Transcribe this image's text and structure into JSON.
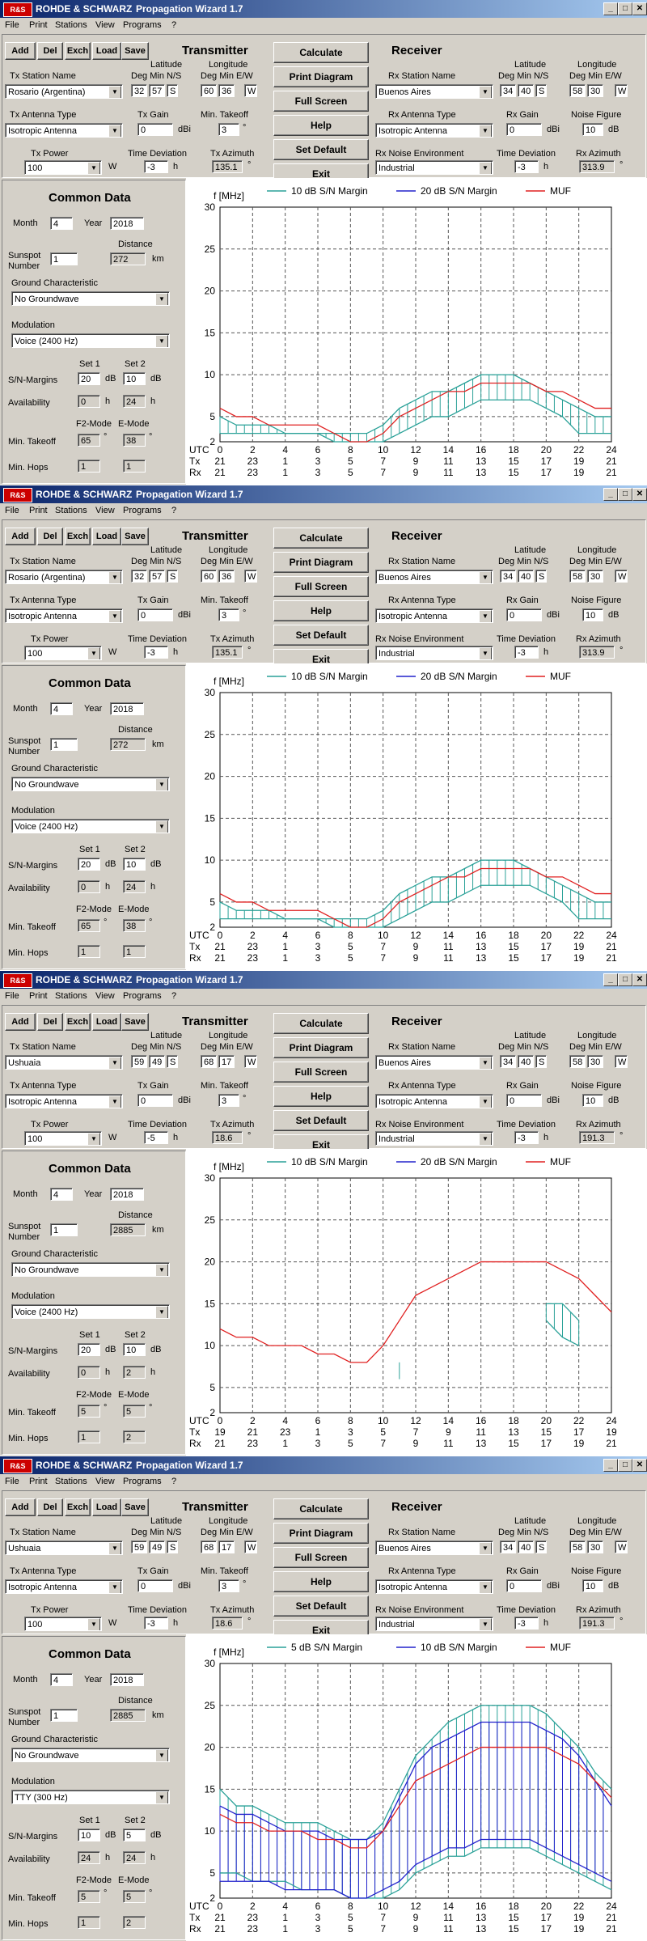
{
  "app": {
    "brand": "ROHDE & SCHWARZ",
    "brand_short": "R&S",
    "title": "Propagation Wizard  1.7"
  },
  "menu": [
    "File",
    "Print",
    "Stations",
    "View",
    "Programs",
    "?"
  ],
  "toolbar": [
    "Add",
    "Del",
    "Exch",
    "Load",
    "Save"
  ],
  "actions": [
    "Calculate",
    "Print Diagram",
    "Full Screen",
    "Help",
    "Set Default",
    "Exit"
  ],
  "labels": {
    "transmitter": "Transmitter",
    "receiver": "Receiver",
    "common": "Common Data",
    "tx_station": "Tx Station Name",
    "rx_station": "Rx Station Name",
    "latitude": "Latitude",
    "longitude": "Longitude",
    "lat_sub": "Deg  Min  N/S",
    "lon_sub": "Deg  Min E/W",
    "tx_ant": "Tx Antenna Type",
    "tx_gain": "Tx Gain",
    "min_takeoff": "Min. Takeoff",
    "rx_ant": "Rx Antenna Type",
    "rx_gain": "Rx Gain",
    "noise_fig": "Noise Figure",
    "tx_power": "Tx Power",
    "time_dev": "Time Deviation",
    "tx_az": "Tx Azimuth",
    "rx_noise": "Rx Noise Environment",
    "rx_az": "Rx Azimuth",
    "dbi": "dBi",
    "db": "dB",
    "deg": "°",
    "h": "h",
    "w": "W",
    "km": "km",
    "month": "Month",
    "year": "Year",
    "sunspot": "Sunspot\nNumber",
    "distance": "Distance",
    "ground": "Ground Characteristic",
    "modulation": "Modulation",
    "sn": "S/N-Margins",
    "avail": "Availability",
    "takeoff": "Min. Takeoff",
    "hops": "Min. Hops",
    "set1": "Set 1",
    "set2": "Set 2",
    "f2": "F2-Mode",
    "emode": "E-Mode",
    "fmhz": "f [MHz]",
    "utc": "UTC",
    "tx": "Tx",
    "rx": "Rx"
  },
  "colors": {
    "margin1": "#2aa198",
    "margin2": "#2222cc",
    "muf": "#e02020",
    "grid": "#555555"
  },
  "windows": [
    {
      "tx": {
        "station": "Rosario (Argentina)",
        "lat_deg": "32",
        "lat_min": "57",
        "lat_ns": "S",
        "lon_deg": "60",
        "lon_min": "36",
        "lon_ew": "W",
        "antenna": "Isotropic Antenna",
        "gain": "0",
        "takeoff": "3",
        "power": "100",
        "timedev": "-3",
        "azimuth": "135.1"
      },
      "rx": {
        "station": "Buenos Aires",
        "lat_deg": "34",
        "lat_min": "40",
        "lat_ns": "S",
        "lon_deg": "58",
        "lon_min": "30",
        "lon_ew": "W",
        "antenna": "Isotropic Antenna",
        "gain": "0",
        "noise": "10",
        "environment": "Industrial",
        "timedev": "-3",
        "azimuth": "313.9"
      },
      "common": {
        "month": "4",
        "year": "2018",
        "sunspot": "1",
        "distance": "272",
        "ground": "No Groundwave",
        "modulation": "Voice   (2400 Hz)",
        "sn1": "20",
        "sn2": "10",
        "av1": "0",
        "av2": "24",
        "f2_1": "65",
        "f2_2": "38",
        "hop1": "1",
        "hop2": "1"
      },
      "tx_hours": [
        "21",
        "23",
        "1",
        "3",
        "5",
        "7",
        "9",
        "11",
        "13",
        "15",
        "17",
        "19",
        "21"
      ],
      "rx_hours": [
        "21",
        "23",
        "1",
        "3",
        "5",
        "7",
        "9",
        "11",
        "13",
        "15",
        "17",
        "19",
        "21"
      ],
      "chart_data": {
        "type": "line",
        "ylabel": "f [MHz]",
        "xlabel": "UTC",
        "x_ticks": [
          0,
          2,
          4,
          6,
          8,
          10,
          12,
          14,
          16,
          18,
          20,
          22,
          24
        ],
        "y_ticks": [
          2,
          5,
          10,
          15,
          20,
          25,
          30
        ],
        "ylim": [
          2,
          30
        ],
        "xlim": [
          0,
          24
        ],
        "legend": [
          "10 dB S/N Margin",
          "20 dB S/N Margin",
          "MUF"
        ],
        "x": [
          0,
          1,
          2,
          3,
          4,
          5,
          6,
          7,
          8,
          9,
          10,
          11,
          12,
          13,
          14,
          15,
          16,
          17,
          18,
          19,
          20,
          21,
          22,
          23,
          24
        ],
        "series": [
          {
            "name": "MUF",
            "values": [
              6,
              5,
              5,
              4,
              4,
              4,
              4,
              3,
              2,
              2,
              3,
              5,
              6,
              7,
              8,
              8,
              9,
              9,
              9,
              9,
              8,
              8,
              7,
              6,
              6
            ]
          },
          {
            "name": "10 dB S/N Margin upper",
            "values": [
              5,
              4,
              4,
              4,
              3,
              3,
              3,
              3,
              3,
              3,
              4,
              6,
              7,
              8,
              8,
              9,
              10,
              10,
              10,
              9,
              8,
              7,
              6,
              5,
              5
            ]
          },
          {
            "name": "10 dB S/N Margin lower",
            "values": [
              3,
              3,
              3,
              3,
              3,
              3,
              3,
              2,
              2,
              2,
              2,
              3,
              4,
              5,
              5,
              6,
              7,
              7,
              7,
              7,
              6,
              5,
              3,
              3,
              3
            ]
          }
        ]
      }
    },
    {
      "tx": {
        "station": "Rosario (Argentina)",
        "lat_deg": "32",
        "lat_min": "57",
        "lat_ns": "S",
        "lon_deg": "60",
        "lon_min": "36",
        "lon_ew": "W",
        "antenna": "Isotropic Antenna",
        "gain": "0",
        "takeoff": "3",
        "power": "100",
        "timedev": "-3",
        "azimuth": "135.1"
      },
      "rx": {
        "station": "Buenos Aires",
        "lat_deg": "34",
        "lat_min": "40",
        "lat_ns": "S",
        "lon_deg": "58",
        "lon_min": "30",
        "lon_ew": "W",
        "antenna": "Isotropic Antenna",
        "gain": "0",
        "noise": "10",
        "environment": "Industrial",
        "timedev": "-3",
        "azimuth": "313.9"
      },
      "common": {
        "month": "4",
        "year": "2018",
        "sunspot": "1",
        "distance": "272",
        "ground": "No Groundwave",
        "modulation": "Voice   (2400 Hz)",
        "sn1": "20",
        "sn2": "10",
        "av1": "0",
        "av2": "24",
        "f2_1": "65",
        "f2_2": "38",
        "hop1": "1",
        "hop2": "1"
      },
      "tx_hours": [
        "21",
        "23",
        "1",
        "3",
        "5",
        "7",
        "9",
        "11",
        "13",
        "15",
        "17",
        "19",
        "21"
      ],
      "rx_hours": [
        "21",
        "23",
        "1",
        "3",
        "5",
        "7",
        "9",
        "11",
        "13",
        "15",
        "17",
        "19",
        "21"
      ],
      "chart_data": {
        "type": "line",
        "ylabel": "f [MHz]",
        "xlabel": "UTC",
        "x_ticks": [
          0,
          2,
          4,
          6,
          8,
          10,
          12,
          14,
          16,
          18,
          20,
          22,
          24
        ],
        "y_ticks": [
          2,
          5,
          10,
          15,
          20,
          25,
          30
        ],
        "ylim": [
          2,
          30
        ],
        "xlim": [
          0,
          24
        ],
        "legend": [
          "10 dB S/N Margin",
          "20 dB S/N Margin",
          "MUF"
        ],
        "x": [
          0,
          1,
          2,
          3,
          4,
          5,
          6,
          7,
          8,
          9,
          10,
          11,
          12,
          13,
          14,
          15,
          16,
          17,
          18,
          19,
          20,
          21,
          22,
          23,
          24
        ],
        "series": [
          {
            "name": "MUF",
            "values": [
              6,
              5,
              5,
              4,
              4,
              4,
              4,
              3,
              2,
              2,
              3,
              5,
              6,
              7,
              8,
              8,
              9,
              9,
              9,
              9,
              8,
              8,
              7,
              6,
              6
            ]
          },
          {
            "name": "10 dB S/N Margin upper",
            "values": [
              5,
              4,
              4,
              4,
              3,
              3,
              3,
              3,
              3,
              3,
              4,
              6,
              7,
              8,
              8,
              9,
              10,
              10,
              10,
              9,
              8,
              7,
              6,
              5,
              5
            ]
          },
          {
            "name": "10 dB S/N Margin lower",
            "values": [
              3,
              3,
              3,
              3,
              3,
              3,
              3,
              2,
              2,
              2,
              2,
              3,
              4,
              5,
              5,
              6,
              7,
              7,
              7,
              7,
              6,
              5,
              3,
              3,
              3
            ]
          }
        ]
      }
    },
    {
      "tx": {
        "station": "Ushuaia",
        "lat_deg": "59",
        "lat_min": "49",
        "lat_ns": "S",
        "lon_deg": "68",
        "lon_min": "17",
        "lon_ew": "W",
        "antenna": "Isotropic Antenna",
        "gain": "0",
        "takeoff": "3",
        "power": "100",
        "timedev": "-5",
        "azimuth": "18.6"
      },
      "rx": {
        "station": "Buenos Aires",
        "lat_deg": "34",
        "lat_min": "40",
        "lat_ns": "S",
        "lon_deg": "58",
        "lon_min": "30",
        "lon_ew": "W",
        "antenna": "Isotropic Antenna",
        "gain": "0",
        "noise": "10",
        "environment": "Industrial",
        "timedev": "-3",
        "azimuth": "191.3"
      },
      "common": {
        "month": "4",
        "year": "2018",
        "sunspot": "1",
        "distance": "2885",
        "ground": "No Groundwave",
        "modulation": "Voice   (2400 Hz)",
        "sn1": "20",
        "sn2": "10",
        "av1": "0",
        "av2": "2",
        "f2_1": "5",
        "f2_2": "5",
        "hop1": "1",
        "hop2": "2"
      },
      "tx_hours": [
        "19",
        "21",
        "23",
        "1",
        "3",
        "5",
        "7",
        "9",
        "11",
        "13",
        "15",
        "17",
        "19"
      ],
      "rx_hours": [
        "21",
        "23",
        "1",
        "3",
        "5",
        "7",
        "9",
        "11",
        "13",
        "15",
        "17",
        "19",
        "21"
      ],
      "chart_data": {
        "type": "line",
        "ylabel": "f [MHz]",
        "xlabel": "UTC",
        "x_ticks": [
          0,
          2,
          4,
          6,
          8,
          10,
          12,
          14,
          16,
          18,
          20,
          22,
          24
        ],
        "y_ticks": [
          2,
          5,
          10,
          15,
          20,
          25,
          30
        ],
        "ylim": [
          2,
          30
        ],
        "xlim": [
          0,
          24
        ],
        "legend": [
          "10 dB S/N Margin",
          "20 dB S/N Margin",
          "MUF"
        ],
        "x": [
          0,
          1,
          2,
          3,
          4,
          5,
          6,
          7,
          8,
          9,
          10,
          11,
          12,
          13,
          14,
          15,
          16,
          17,
          18,
          19,
          20,
          21,
          22,
          23,
          24
        ],
        "series": [
          {
            "name": "MUF",
            "values": [
              12,
              11,
              11,
              10,
              10,
              10,
              9,
              9,
              8,
              8,
              10,
              13,
              16,
              17,
              18,
              19,
              20,
              20,
              20,
              20,
              20,
              19,
              18,
              16,
              14
            ]
          },
          {
            "name": "10 dB S/N Margin upper",
            "values": [
              null,
              null,
              null,
              null,
              null,
              null,
              null,
              null,
              null,
              null,
              null,
              8,
              null,
              null,
              null,
              null,
              null,
              null,
              null,
              null,
              15,
              15,
              13,
              null,
              null
            ]
          },
          {
            "name": "10 dB S/N Margin lower",
            "values": [
              null,
              null,
              null,
              null,
              null,
              null,
              null,
              null,
              null,
              null,
              null,
              6,
              null,
              null,
              null,
              null,
              null,
              null,
              null,
              null,
              13,
              11,
              10,
              null,
              null
            ]
          }
        ]
      }
    },
    {
      "tx": {
        "station": "Ushuaia",
        "lat_deg": "59",
        "lat_min": "49",
        "lat_ns": "S",
        "lon_deg": "68",
        "lon_min": "17",
        "lon_ew": "W",
        "antenna": "Isotropic Antenna",
        "gain": "0",
        "takeoff": "3",
        "power": "100",
        "timedev": "-3",
        "azimuth": "18.6"
      },
      "rx": {
        "station": "Buenos Aires",
        "lat_deg": "34",
        "lat_min": "40",
        "lat_ns": "S",
        "lon_deg": "58",
        "lon_min": "30",
        "lon_ew": "W",
        "antenna": "Isotropic Antenna",
        "gain": "0",
        "noise": "10",
        "environment": "Industrial",
        "timedev": "-3",
        "azimuth": "191.3"
      },
      "common": {
        "month": "4",
        "year": "2018",
        "sunspot": "1",
        "distance": "2885",
        "ground": "No Groundwave",
        "modulation": "TTY   (300 Hz)",
        "sn1": "10",
        "sn2": "5",
        "av1": "24",
        "av2": "24",
        "f2_1": "5",
        "f2_2": "5",
        "hop1": "1",
        "hop2": "2"
      },
      "tx_hours": [
        "21",
        "23",
        "1",
        "3",
        "5",
        "7",
        "9",
        "11",
        "13",
        "15",
        "17",
        "19",
        "21"
      ],
      "rx_hours": [
        "21",
        "23",
        "1",
        "3",
        "5",
        "7",
        "9",
        "11",
        "13",
        "15",
        "17",
        "19",
        "21"
      ],
      "chart_data": {
        "type": "line",
        "ylabel": "f [MHz]",
        "xlabel": "UTC",
        "x_ticks": [
          0,
          2,
          4,
          6,
          8,
          10,
          12,
          14,
          16,
          18,
          20,
          22,
          24
        ],
        "y_ticks": [
          2,
          5,
          10,
          15,
          20,
          25,
          30
        ],
        "ylim": [
          2,
          30
        ],
        "xlim": [
          0,
          24
        ],
        "legend": [
          "5 dB S/N Margin",
          "10 dB S/N Margin",
          "MUF"
        ],
        "x": [
          0,
          1,
          2,
          3,
          4,
          5,
          6,
          7,
          8,
          9,
          10,
          11,
          12,
          13,
          14,
          15,
          16,
          17,
          18,
          19,
          20,
          21,
          22,
          23,
          24
        ],
        "series": [
          {
            "name": "MUF",
            "values": [
              12,
              11,
              11,
              10,
              10,
              10,
              9,
              9,
              8,
              8,
              10,
              13,
              16,
              17,
              18,
              19,
              20,
              20,
              20,
              20,
              20,
              19,
              18,
              16,
              14
            ]
          },
          {
            "name": "5 dB S/N Margin upper",
            "values": [
              15,
              13,
              13,
              12,
              11,
              11,
              11,
              10,
              9,
              9,
              11,
              15,
              19,
              21,
              23,
              24,
              25,
              25,
              25,
              25,
              24,
              22,
              20,
              17,
              15
            ]
          },
          {
            "name": "5 dB S/N Margin lower",
            "values": [
              5,
              5,
              4,
              4,
              4,
              3,
              3,
              3,
              2,
              2,
              2,
              3,
              5,
              6,
              7,
              7,
              8,
              8,
              8,
              8,
              7,
              6,
              5,
              4,
              3
            ]
          },
          {
            "name": "10 dB S/N Margin upper",
            "values": [
              13,
              12,
              12,
              11,
              10,
              10,
              10,
              9,
              9,
              9,
              10,
              14,
              18,
              20,
              21,
              22,
              23,
              23,
              23,
              23,
              22,
              21,
              19,
              16,
              13
            ]
          },
          {
            "name": "10 dB S/N Margin lower",
            "values": [
              4,
              4,
              4,
              4,
              3,
              3,
              3,
              3,
              2,
              2,
              3,
              4,
              6,
              7,
              8,
              8,
              9,
              9,
              9,
              9,
              8,
              7,
              6,
              5,
              4
            ]
          }
        ]
      }
    }
  ]
}
